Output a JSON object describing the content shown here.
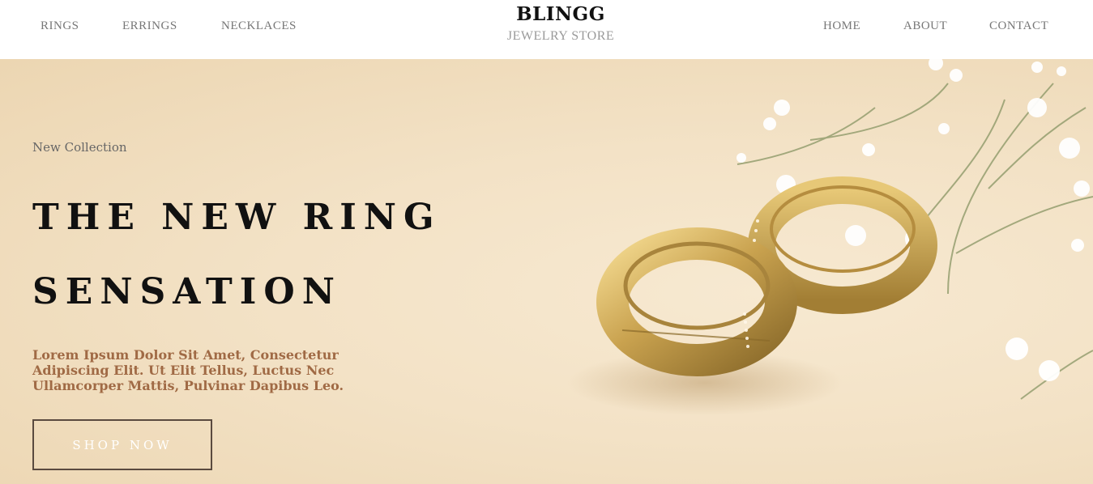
{
  "nav": {
    "left": [
      "RINGS",
      "ERRINGS",
      "NECKLACES"
    ],
    "right": [
      "HOME",
      "ABOUT",
      "CONTACT"
    ]
  },
  "brand": {
    "title": "BLINGG",
    "subtitle": "JEWELRY STORE"
  },
  "hero": {
    "kicker": "New Collection",
    "headline_line1": "THE NEW RING",
    "headline_line2": "SENSATION",
    "lead": "Lorem Ipsum Dolor Sit Amet, Consectetur Adipiscing Elit. Ut Elit Tellus, Luctus Nec Ullamcorper Mattis, Pulvinar Dapibus Leo.",
    "cta": "SHOP NOW",
    "image": "gold-rings-photo"
  },
  "colors": {
    "hero_bg": "#f3e2c6",
    "lead_text": "#a06a45",
    "heading": "#111111"
  }
}
